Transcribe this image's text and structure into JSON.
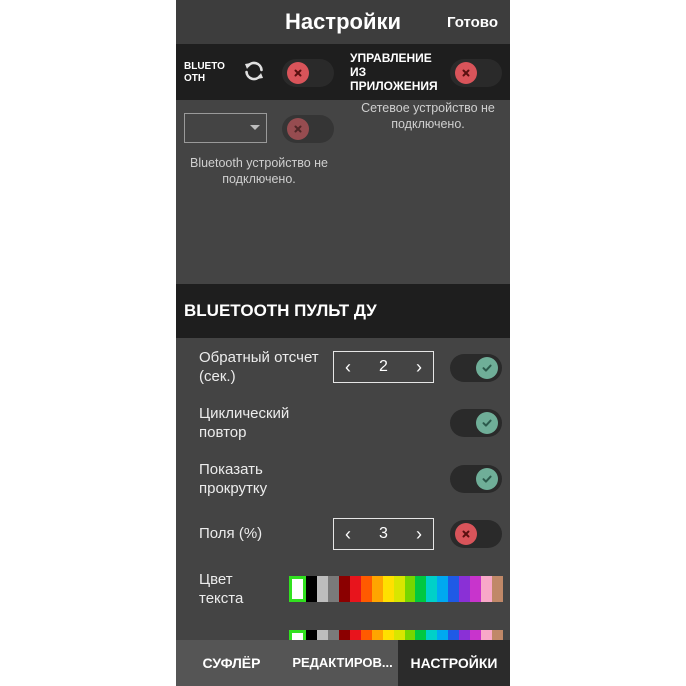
{
  "header": {
    "title": "Настройки",
    "done_label": "Готово"
  },
  "connection": {
    "bluetooth_label": "BLUETO OTH",
    "app_control_label": "УПРАВЛЕНИЕ ИЗ ПРИЛОЖЕНИЯ",
    "bluetooth_toggle": "off",
    "app_control_toggle": "off",
    "device_toggle": "off",
    "device_select_value": "",
    "network_status": "Сетевое устройство не подключено.",
    "bluetooth_status": "Bluetooth устройство не подключено."
  },
  "remote_section": {
    "title": "BLUETOOTH ПУЛЬТ ДУ",
    "countdown_label": "Обратный отсчет (сек.)",
    "countdown_value": "2",
    "countdown_toggle": "on",
    "cyclic_label": "Циклический повтор",
    "cyclic_toggle": "on",
    "show_scroll_label": "Показать прокрутку",
    "show_scroll_toggle": "on",
    "margins_label": "Поля (%)",
    "margins_value": "3",
    "margins_toggle": "off",
    "text_color_label": "Цвет текста"
  },
  "stepper_icons": {
    "decrement": "‹",
    "increment": "›"
  },
  "palette_colors": [
    "#ffffff",
    "#000000",
    "#bdbdbd",
    "#7a7a7a",
    "#8b0000",
    "#e8141c",
    "#ff5a00",
    "#ffa500",
    "#ffe000",
    "#d8e600",
    "#76d600",
    "#00c840",
    "#00d0c8",
    "#00a8f0",
    "#1e5ae6",
    "#8a30d6",
    "#c834cc",
    "#f8a8c8",
    "#c08868"
  ],
  "selected_color_index": 0,
  "tabs": [
    {
      "label": "СУФЛЁР"
    },
    {
      "label": "РЕДАКТИРОВ..."
    },
    {
      "label": "НАСТРОЙКИ"
    }
  ],
  "colors": {
    "toggle_off": "#d9545a",
    "toggle_on": "#6fae98",
    "swatch_selected_border": "#31e11f"
  }
}
